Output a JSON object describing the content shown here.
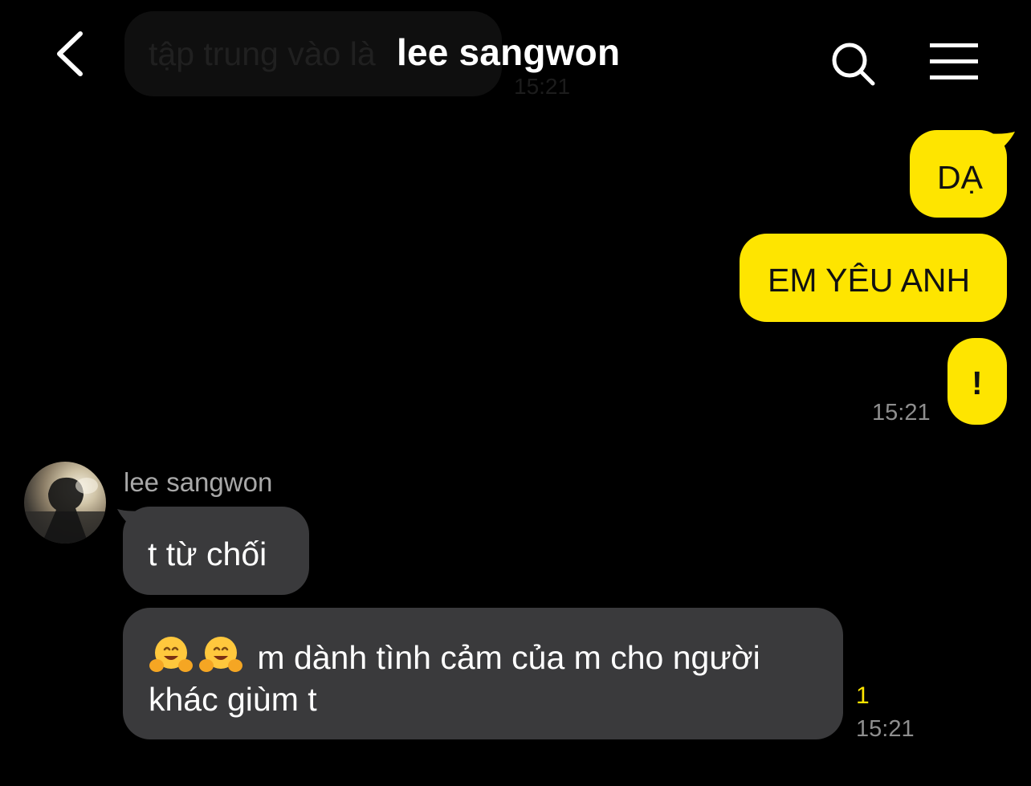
{
  "header": {
    "title": "lee sangwon",
    "back_icon": "chevron-left-icon",
    "search_icon": "search-icon",
    "menu_icon": "hamburger-menu-icon"
  },
  "ghost_message": {
    "text": "tập trung vào là",
    "time": "15:21"
  },
  "sent_messages": [
    {
      "text": "DẠ"
    },
    {
      "text": "EM YÊU ANH"
    },
    {
      "text": "!"
    }
  ],
  "sent_time": "15:21",
  "received": {
    "sender_name": "lee sangwon",
    "messages": [
      {
        "text": "t từ chối"
      },
      {
        "emoji": "hugging-face-emoji",
        "text": "m dành tình cảm của m cho người khác giùm t"
      }
    ],
    "unread_count": "1",
    "time": "15:21"
  },
  "colors": {
    "background": "#000000",
    "sent_bubble": "#FEE500",
    "received_bubble": "#3a3a3c",
    "timestamp": "#8e8e8e",
    "unread": "#FEE500"
  }
}
